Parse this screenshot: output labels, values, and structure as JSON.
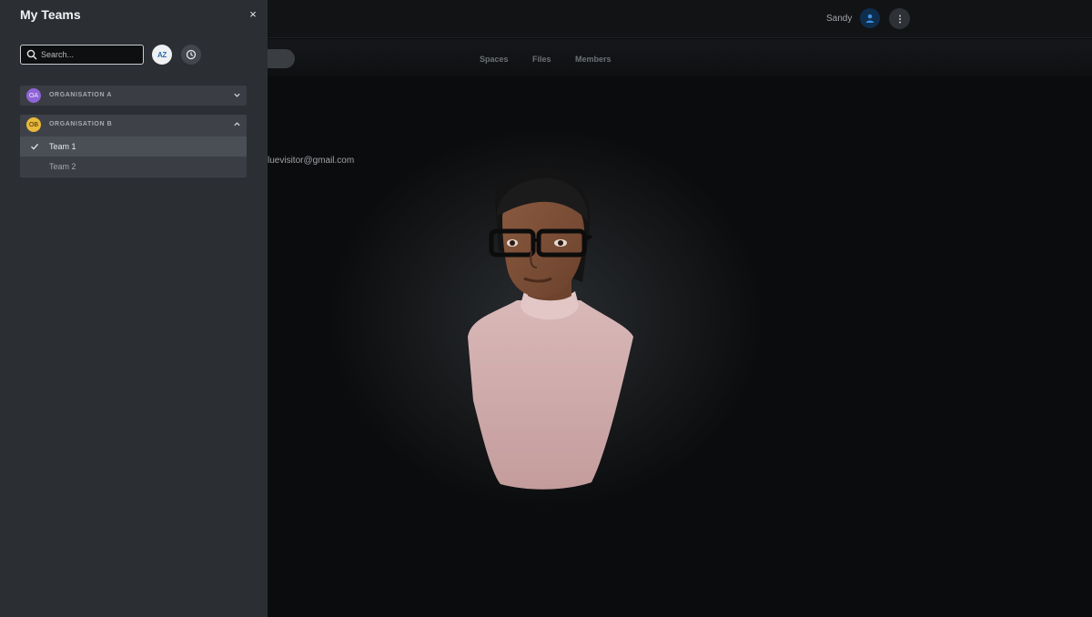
{
  "header": {
    "user_name": "Sandy"
  },
  "subnav": {
    "tabs": [
      "Spaces",
      "Files",
      "Members"
    ]
  },
  "profile": {
    "email": "luevisitor@gmail.com"
  },
  "panel": {
    "title": "My Teams",
    "close_label": "×",
    "search_placeholder": "Search...",
    "sort_az_label": "AZ",
    "organisations": [
      {
        "initials": "OA",
        "name": "ORGANISATION A",
        "expanded": false,
        "color": "#8f64d6"
      },
      {
        "initials": "OB",
        "name": "ORGANISATION B",
        "expanded": true,
        "color": "#e9b93a",
        "teams": [
          {
            "name": "Team 1",
            "selected": true
          },
          {
            "name": "Team 2",
            "selected": false
          }
        ]
      }
    ]
  },
  "colors": {
    "panel_bg": "#2b2f34",
    "accent": "#2f6fb0"
  },
  "icons": {
    "search": "search-icon",
    "close": "close-icon",
    "recent": "clock-icon",
    "more": "more-vertical-icon",
    "chevron": "chevron-icon",
    "check": "check-icon",
    "user": "user-icon"
  }
}
